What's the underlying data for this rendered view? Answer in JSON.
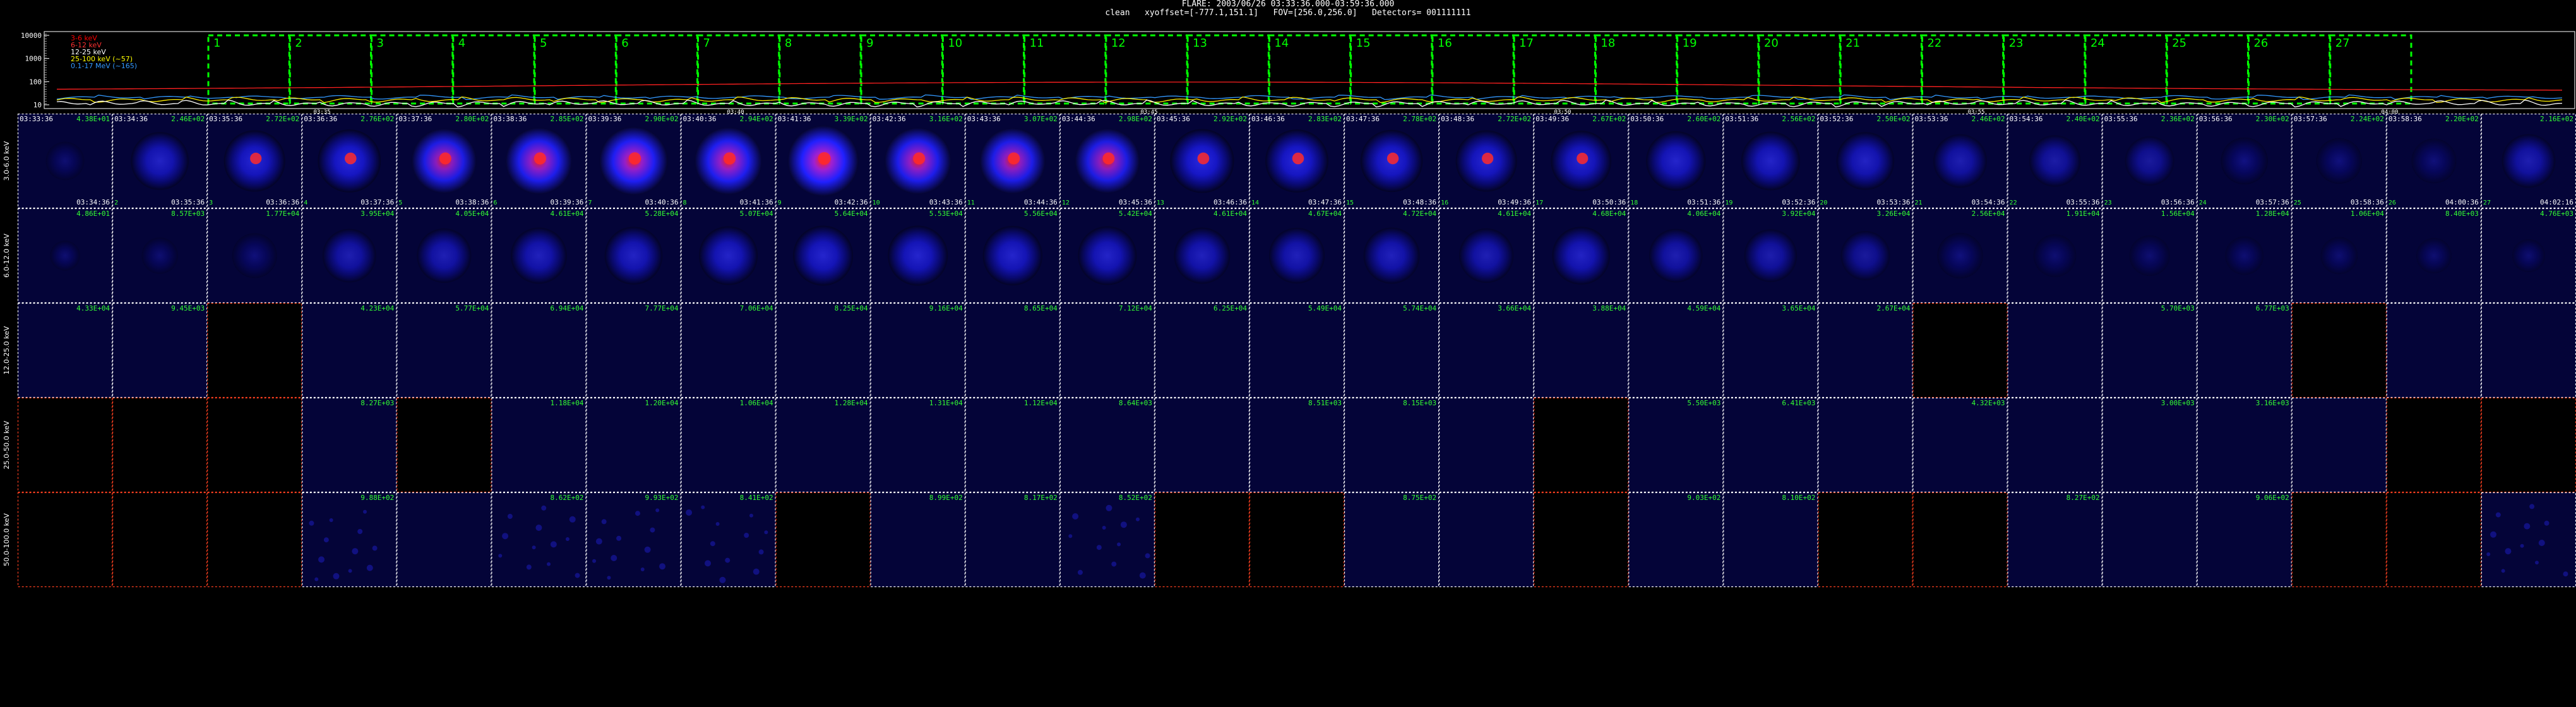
{
  "header": {
    "line1": "FLARE: 2003/06/26 03:33:36.000-03:59:36.000",
    "line2": "clean   xyoffset=[-777.1,151.1]   FOV=[256.0,256.0]   Detectors= 001111111"
  },
  "lightcurve": {
    "y_ticks": [
      "10000",
      "1000",
      "100",
      "10"
    ],
    "x_ticks": [
      "03:35",
      "03:40",
      "03:45",
      "03:50",
      "03:55",
      "04:00"
    ],
    "legend": [
      {
        "text": "3-6 keV",
        "color": "#ff0000"
      },
      {
        "text": "6-12 keV",
        "color": "#ff3030"
      },
      {
        "text": "12-25 keV",
        "color": "#ffffff"
      },
      {
        "text": "25-100 keV (~57)",
        "color": "#ffff00"
      },
      {
        "text": "0.1-17 MeV (~165)",
        "color": "#3399ff"
      }
    ],
    "interval_numbers": [
      "1",
      "2",
      "3",
      "4",
      "5",
      "6",
      "7",
      "8",
      "9",
      "10",
      "11",
      "12",
      "13",
      "14",
      "15",
      "16",
      "17",
      "18",
      "19",
      "20",
      "21",
      "22",
      "23",
      "24",
      "25",
      "26",
      "27"
    ],
    "colors": {
      "interval_box": "#00ff00",
      "curve_red": "#ff2020",
      "curve_yellow": "#ffee00",
      "curve_blue": "#3399ff",
      "curve_white": "#ffffff"
    }
  },
  "energy_bands": [
    "3.0-6.0 keV",
    "6.0-12.0 keV",
    "12.0-25.0 keV",
    "25.0-50.0 keV",
    "50.0-100.0 keV"
  ],
  "start_times": [
    "03:33:36",
    "03:34:36",
    "03:35:36",
    "03:36:36",
    "03:37:36",
    "03:38:36",
    "03:39:36",
    "03:40:36",
    "03:41:36",
    "03:42:36",
    "03:43:36",
    "03:44:36",
    "03:45:36",
    "03:46:36",
    "03:47:36",
    "03:48:36",
    "03:49:36",
    "03:50:36",
    "03:51:36",
    "03:52:36",
    "03:53:36",
    "03:54:36",
    "03:55:36",
    "03:56:36",
    "03:57:36",
    "03:58:36"
  ],
  "end_times": [
    "03:34:36",
    "03:35:36",
    "03:36:36",
    "03:37:36",
    "03:38:36",
    "03:39:36",
    "03:40:36",
    "03:41:36",
    "03:42:36",
    "03:43:36",
    "03:44:36",
    "03:45:36",
    "03:46:36",
    "03:47:36",
    "03:48:36",
    "03:49:36",
    "03:50:36",
    "03:51:36",
    "03:52:36",
    "03:53:36",
    "03:54:36",
    "03:55:36",
    "03:56:36",
    "03:57:36",
    "03:58:36",
    "04:00:36",
    "04:02:16"
  ],
  "bands": [
    {
      "peaks": [
        "4.38E+01",
        "2.46E+02",
        "2.72E+02",
        "2.76E+02",
        "2.80E+02",
        "2.85E+02",
        "2.90E+02",
        "2.94E+02",
        "3.39E+02",
        "3.16E+02",
        "3.07E+02",
        "2.98E+02",
        "2.92E+02",
        "2.83E+02",
        "2.78E+02",
        "2.72E+02",
        "2.67E+02",
        "2.60E+02",
        "2.56E+02",
        "2.50E+02",
        "2.46E+02",
        "2.40E+02",
        "2.36E+02",
        "2.30E+02",
        "2.24E+02",
        "2.20E+02",
        "2.16E+02"
      ],
      "brightness": [
        0.25,
        0.7,
        0.78,
        0.82,
        0.86,
        0.9,
        0.94,
        0.92,
        1.0,
        0.9,
        0.88,
        0.86,
        0.84,
        0.82,
        0.8,
        0.78,
        0.76,
        0.74,
        0.72,
        0.7,
        0.6,
        0.55,
        0.5,
        0.45,
        0.42,
        0.4,
        0.6
      ],
      "panel_type": [
        "image",
        "image",
        "image",
        "image",
        "image",
        "image",
        "image",
        "image",
        "image",
        "image",
        "image",
        "image",
        "image",
        "image",
        "image",
        "image",
        "image",
        "image",
        "image",
        "image",
        "image",
        "image",
        "image",
        "image",
        "image",
        "image",
        "image"
      ]
    },
    {
      "peaks": [
        "4.86E+01",
        "8.57E+03",
        "1.77E+04",
        "3.95E+04",
        "4.05E+04",
        "4.61E+04",
        "5.28E+04",
        "5.07E+04",
        "5.64E+04",
        "5.53E+04",
        "5.56E+04",
        "5.42E+04",
        "4.61E+04",
        "4.67E+04",
        "4.72E+04",
        "4.61E+04",
        "4.68E+04",
        "4.06E+04",
        "3.92E+04",
        "3.26E+04",
        "2.56E+04",
        "1.91E+04",
        "1.56E+04",
        "1.28E+04",
        "1.06E+04",
        "8.40E+03",
        "4.76E+03"
      ],
      "brightness": [
        0.05,
        0.2,
        0.4,
        0.6,
        0.62,
        0.66,
        0.7,
        0.72,
        0.75,
        0.75,
        0.74,
        0.72,
        0.66,
        0.65,
        0.66,
        0.62,
        0.7,
        0.6,
        0.58,
        0.5,
        0.42,
        0.35,
        0.3,
        0.25,
        0.22,
        0.18,
        0.12
      ],
      "panel_type": [
        "image",
        "image",
        "image",
        "image",
        "image",
        "image",
        "image",
        "image",
        "image",
        "image",
        "image",
        "image",
        "image",
        "image",
        "image",
        "image",
        "image",
        "image",
        "image",
        "image",
        "image",
        "image",
        "image",
        "image",
        "image",
        "image",
        "image"
      ]
    },
    {
      "peaks": [
        "4.33E+04",
        "9.45E+03",
        "",
        "4.23E+04",
        "5.77E+04",
        "6.94E+04",
        "7.77E+04",
        "7.06E+04",
        "8.25E+04",
        "9.16E+04",
        "8.65E+04",
        "7.12E+04",
        "6.25E+04",
        "5.49E+04",
        "5.74E+04",
        "3.66E+04",
        "3.88E+04",
        "4.59E+04",
        "3.65E+04",
        "2.67E+04",
        "",
        "",
        "5.70E+03",
        "6.77E+03",
        "",
        "",
        ""
      ],
      "brightness": [
        0.05,
        0.05,
        0,
        0.06,
        0.06,
        0.06,
        0.06,
        0.06,
        0.06,
        0.06,
        0.06,
        0.06,
        0.06,
        0.06,
        0.06,
        0.06,
        0.06,
        0.06,
        0.06,
        0.06,
        0,
        0,
        0.05,
        0.05,
        0,
        0,
        0.05
      ],
      "panel_type": [
        "empty",
        "empty",
        "blank",
        "empty",
        "empty",
        "empty",
        "empty",
        "empty",
        "empty",
        "empty",
        "empty",
        "empty",
        "empty",
        "empty",
        "empty",
        "empty",
        "empty",
        "empty",
        "empty",
        "empty",
        "blank",
        "empty",
        "empty",
        "empty",
        "blank",
        "empty",
        "empty"
      ]
    },
    {
      "peaks": [
        "",
        "",
        "",
        "8.27E+03",
        "",
        "1.18E+04",
        "1.20E+04",
        "1.06E+04",
        "1.28E+04",
        "1.31E+04",
        "1.12E+04",
        "8.64E+03",
        "",
        "8.51E+03",
        "8.15E+03",
        "",
        "",
        "5.50E+03",
        "6.41E+03",
        "",
        "4.32E+03",
        "",
        "3.00E+03",
        "3.16E+03",
        "",
        "",
        ""
      ],
      "brightness": [
        0,
        0,
        0,
        0.05,
        0,
        0.05,
        0.05,
        0.05,
        0.05,
        0.05,
        0.05,
        0.05,
        0.05,
        0.05,
        0.05,
        0.05,
        0,
        0.05,
        0.05,
        0.05,
        0.05,
        0.05,
        0.05,
        0.05,
        0.05,
        0,
        0
      ],
      "panel_type": [
        "blank",
        "blank",
        "blank",
        "empty",
        "blank",
        "empty",
        "empty",
        "empty",
        "empty",
        "empty",
        "empty",
        "empty",
        "empty",
        "empty",
        "empty",
        "empty",
        "blank",
        "empty",
        "empty",
        "empty",
        "empty",
        "empty",
        "empty",
        "empty",
        "empty",
        "blank",
        "blank"
      ]
    },
    {
      "peaks": [
        "",
        "",
        "",
        "9.88E+02",
        "",
        "8.62E+02",
        "9.93E+02",
        "8.41E+02",
        "",
        "8.99E+02",
        "8.17E+02",
        "8.52E+02",
        "",
        "",
        "8.75E+02",
        "",
        "",
        "9.03E+02",
        "8.10E+02",
        "",
        "",
        "8.27E+02",
        "",
        "9.06E+02",
        "",
        "",
        ""
      ],
      "brightness": [
        0,
        0,
        0,
        0.08,
        0.05,
        0.08,
        0.08,
        0.08,
        0,
        0.06,
        0.06,
        0.06,
        0,
        0,
        0.06,
        0.05,
        0,
        0.06,
        0.06,
        0,
        0,
        0.06,
        0.05,
        0.06,
        0,
        0,
        0.08
      ],
      "panel_type": [
        "blank",
        "blank",
        "blank",
        "noise",
        "empty",
        "noise",
        "noise",
        "noise",
        "blank",
        "empty",
        "empty",
        "noise",
        "blank",
        "blank",
        "empty",
        "empty",
        "blank",
        "empty",
        "empty",
        "blank",
        "blank",
        "empty",
        "empty",
        "empty",
        "blank",
        "blank",
        "noise"
      ]
    }
  ]
}
